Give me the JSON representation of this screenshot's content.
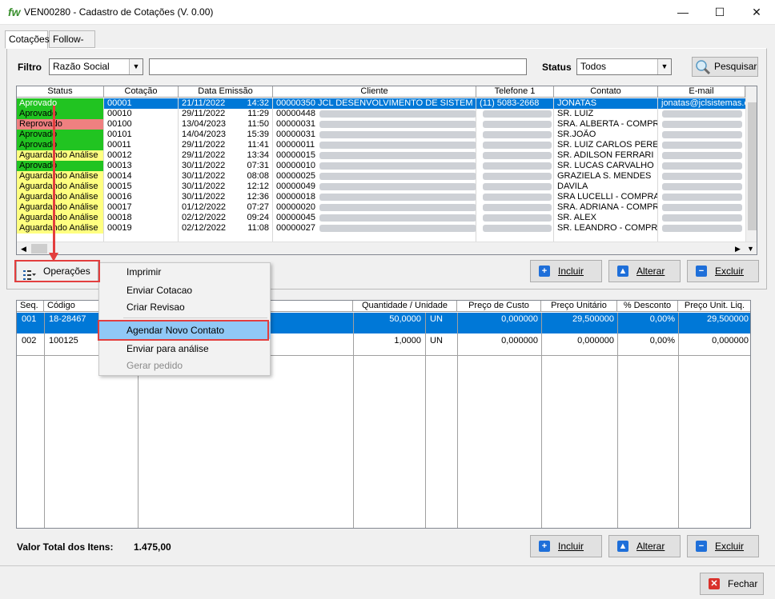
{
  "window": {
    "logo": "fw",
    "title": "VEN00280  -  Cadastro de Cotações  (V. 0.00)",
    "minimize": "—",
    "maximize": "☐",
    "close": "✕"
  },
  "tabs": [
    "Cotações",
    "Follow-up"
  ],
  "filter": {
    "label": "Filtro",
    "field_value": "Razão Social",
    "text_value": "",
    "status_label": "Status",
    "status_value": "Todos",
    "search_button": "Pesquisar"
  },
  "quotes_table": {
    "columns": [
      "Status",
      "Cotação",
      "Data Emissão",
      "Cliente",
      "Telefone 1",
      "Contato",
      "E-mail"
    ],
    "rows": [
      {
        "status": "Aprovado",
        "cotacao": "00001",
        "data": "21/11/2022",
        "hora": "14:32",
        "cliente": "00000350  JCL DESENVOLVIMENTO DE SISTEM",
        "telefone": "(11)    5083-2668",
        "contato": "JONATAS",
        "email": "jonatas@jclsistemas.c"
      },
      {
        "status": "Aprovado",
        "cotacao": "00010",
        "data": "29/11/2022",
        "hora": "11:29",
        "cliente": "00000448",
        "telefone": "",
        "contato": "SR. LUIZ",
        "email": ""
      },
      {
        "status": "Reprovado",
        "cotacao": "00100",
        "data": "13/04/2023",
        "hora": "11:50",
        "cliente": "00000031",
        "telefone": "",
        "contato": "SRA. ALBERTA - COMPR",
        "email": ""
      },
      {
        "status": "Aprovado",
        "cotacao": "00101",
        "data": "14/04/2023",
        "hora": "15:39",
        "cliente": "00000031",
        "telefone": "",
        "contato": "SR.JOÃO",
        "email": ""
      },
      {
        "status": "Aprovado",
        "cotacao": "00011",
        "data": "29/11/2022",
        "hora": "11:41",
        "cliente": "00000011",
        "telefone": "",
        "contato": "SR. LUIZ CARLOS PERE",
        "email": ""
      },
      {
        "status": "Aguardando Análise",
        "cotacao": "00012",
        "data": "29/11/2022",
        "hora": "13:34",
        "cliente": "00000015",
        "telefone": "",
        "contato": "SR. ADILSON FERRARI",
        "email": ""
      },
      {
        "status": "Aprovado",
        "cotacao": "00013",
        "data": "30/11/2022",
        "hora": "07:31",
        "cliente": "00000010",
        "telefone": "",
        "contato": "SR. LUCAS CARVALHO",
        "email": ""
      },
      {
        "status": "Aguardando Análise",
        "cotacao": "00014",
        "data": "30/11/2022",
        "hora": "08:08",
        "cliente": "00000025",
        "telefone": "",
        "contato": "GRAZIELA S. MENDES",
        "email": ""
      },
      {
        "status": "Aguardando Análise",
        "cotacao": "00015",
        "data": "30/11/2022",
        "hora": "12:12",
        "cliente": "00000049",
        "telefone": "",
        "contato": "DAVILA",
        "email": ""
      },
      {
        "status": "Aguardando Análise",
        "cotacao": "00016",
        "data": "30/11/2022",
        "hora": "12:36",
        "cliente": "00000018",
        "telefone": "",
        "contato": "SRA LUCELLI - COMPRA",
        "email": ""
      },
      {
        "status": "Aguardando Análise",
        "cotacao": "00017",
        "data": "01/12/2022",
        "hora": "07:27",
        "cliente": "00000020",
        "telefone": "",
        "contato": "SRA. ADRIANA - COMPRA",
        "email": ""
      },
      {
        "status": "Aguardando Análise",
        "cotacao": "00018",
        "data": "02/12/2022",
        "hora": "09:24",
        "cliente": "00000045",
        "telefone": "",
        "contato": "SR. ALEX",
        "email": ""
      },
      {
        "status": "Aguardando Análise",
        "cotacao": "00019",
        "data": "02/12/2022",
        "hora": "11:08",
        "cliente": "00000027",
        "telefone": "",
        "contato": "SR. LEANDRO - COMPRA",
        "email": ""
      }
    ]
  },
  "status_colors": {
    "Aprovado": "#21c421",
    "Reprovado": "#ef8080",
    "Aguardando Análise": "#ffff80"
  },
  "operations_button": "Operações",
  "menu": {
    "items": [
      "Imprimir",
      "Enviar Cotacao",
      "Criar Revisao",
      "Agendar Novo Contato",
      "Enviar para análise",
      "Gerar pedido"
    ]
  },
  "top_buttons": {
    "incluir": "Incluir",
    "alterar": "Alterar",
    "excluir": "Excluir"
  },
  "items_table": {
    "columns": [
      "Seq.",
      "Código",
      "Quantidade / Unidade",
      "Preço de Custo",
      "Preço Unitário",
      "% Desconto",
      "Preço Unit. Liq."
    ],
    "rows": [
      {
        "seq": "001",
        "codigo": "18-28467",
        "qtd": "50,0000",
        "un": "UN",
        "custo": "0,000000",
        "unit": "29,500000",
        "desc": "0,00%",
        "liq": "29,500000"
      },
      {
        "seq": "002",
        "codigo": "100125",
        "qtd": "1,0000",
        "un": "UN",
        "custo": "0,000000",
        "unit": "0,000000",
        "desc": "0,00%",
        "liq": "0,000000"
      }
    ]
  },
  "total": {
    "label": "Valor Total dos Itens:",
    "value": "1.475,00"
  },
  "bottom_buttons": {
    "incluir": "Incluir",
    "alterar": "Alterar",
    "excluir": "Excluir"
  },
  "close_button": "Fechar",
  "colors": {
    "selection": "#0078d7",
    "highlight": "#90c8f6",
    "annotation": "#e33e3e"
  }
}
